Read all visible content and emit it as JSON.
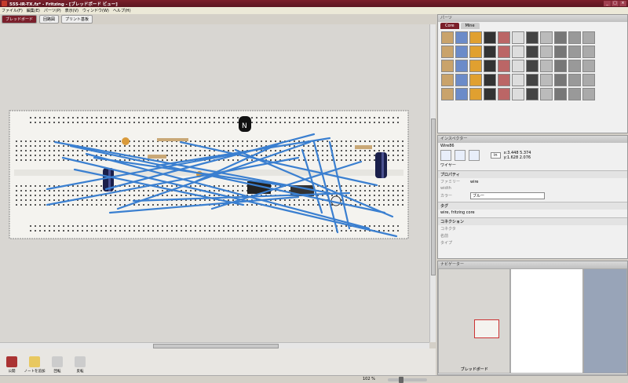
{
  "window": {
    "title": "555-IR-TX.fz* - Fritzing - [ブレッドボード ビュー]"
  },
  "menu": [
    "ファイル(F)",
    "編集(E)",
    "パーツ(P)",
    "表示(V)",
    "ウィンドウ(W)",
    "ヘルプ(H)"
  ],
  "view_tabs": [
    "ブレッドボード",
    "回路図",
    "プリント基板"
  ],
  "toolbar": {
    "items": [
      "公開",
      "ノートを追加",
      "回転",
      "反転"
    ]
  },
  "zoom": {
    "value": "102 %"
  },
  "parts": {
    "title": "パーツ",
    "tabs": [
      "Core",
      "Mine"
    ]
  },
  "inspector": {
    "title": "インスペクター",
    "item_name": "Wire86",
    "coords_a": "x:3.448 5.374",
    "coords_b": "y:1.628 2.076",
    "unit": "in",
    "type_label": "ワイヤー",
    "sections": {
      "properties": "プロパティ",
      "tags": "タグ",
      "connections": "コネクション"
    },
    "properties": {
      "family_label": "ファミリー",
      "family_value": "wire",
      "width_label": "width",
      "color_label": "カラー",
      "color_value": "ブルー"
    },
    "tags_value": "wire, fritzing core",
    "connections": [
      "コネクタ",
      "名前",
      "タイプ"
    ]
  },
  "navigator": {
    "title": "ナビゲーター",
    "label": "ブレッドボード"
  },
  "colors": {
    "accent": "#7a1f2a",
    "wire": "#3a7fd0"
  }
}
